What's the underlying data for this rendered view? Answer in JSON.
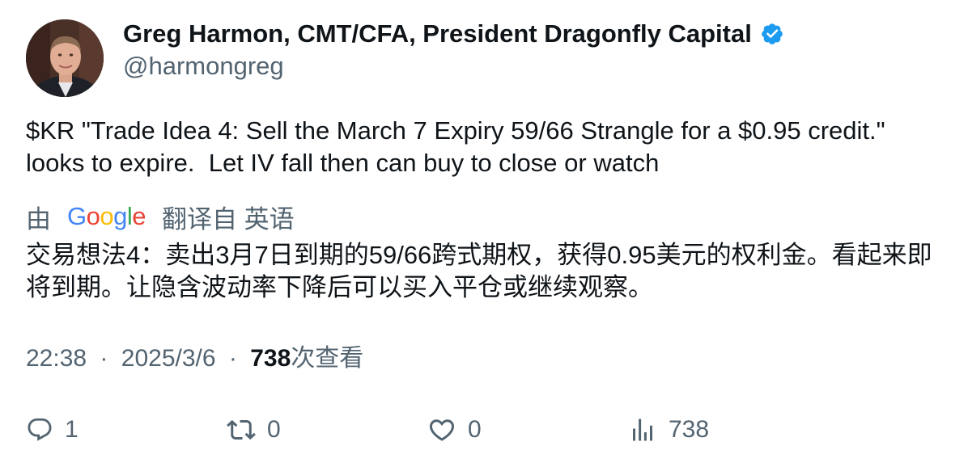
{
  "author": {
    "display_name": "Greg Harmon, CMT/CFA, President Dragonfly Capital",
    "handle": "@harmongreg",
    "verified": true,
    "verified_color": "#1d9bf0"
  },
  "tweet": {
    "text": "$KR \"Trade Idea 4: Sell the March 7 Expiry 59/66 Strangle for a $0.95 credit.\" looks to expire.  Let IV fall then can buy to close or watch",
    "translation": {
      "prefix": "由",
      "provider": "Google",
      "suffix": "翻译自 英语",
      "text": "交易想法4：卖出3月7日到期的59/66跨式期权，获得0.95美元的权利金。看起来即将到期。让隐含波动率下降后可以买入平仓或继续观察。"
    },
    "time": "22:38",
    "sep1": "·",
    "date": "2025/3/6",
    "sep2": "·",
    "views_count": "738",
    "views_label": "次查看"
  },
  "actions": {
    "reply_count": "1",
    "retweet_count": "0",
    "like_count": "0",
    "views_count": "738"
  },
  "colors": {
    "text_primary": "#0f1419",
    "text_secondary": "#536471",
    "google_blue": "#4285f4",
    "google_red": "#ea4335",
    "google_yellow": "#fbbc05",
    "google_green": "#34a853"
  }
}
